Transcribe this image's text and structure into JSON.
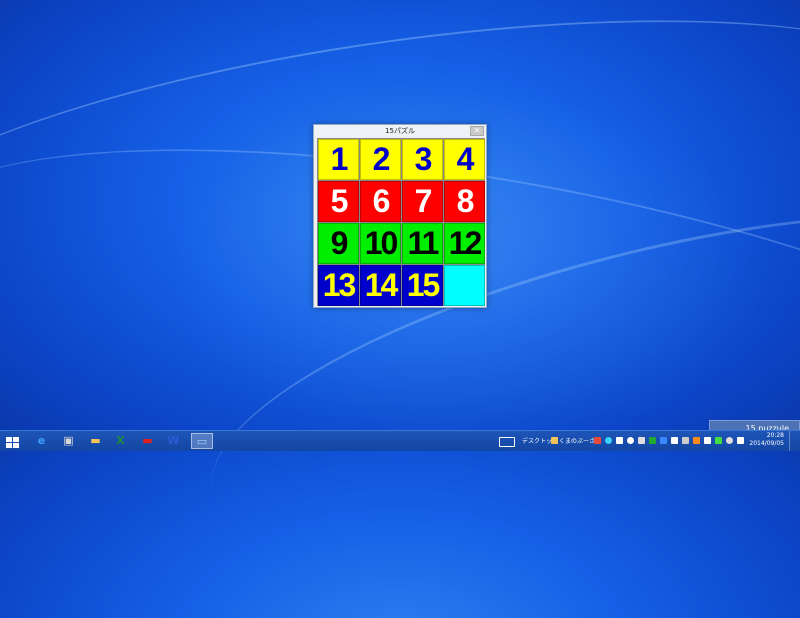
{
  "window": {
    "title": "15パズル",
    "close_symbol": "✕"
  },
  "board": {
    "tiles": [
      {
        "label": "1",
        "bg": "#ffff00",
        "fg": "#0000c8"
      },
      {
        "label": "2",
        "bg": "#ffff00",
        "fg": "#0000c8"
      },
      {
        "label": "3",
        "bg": "#ffff00",
        "fg": "#0000c8"
      },
      {
        "label": "4",
        "bg": "#ffff00",
        "fg": "#0000c8"
      },
      {
        "label": "5",
        "bg": "#ff0000",
        "fg": "#ffffff"
      },
      {
        "label": "6",
        "bg": "#ff0000",
        "fg": "#ffffff"
      },
      {
        "label": "7",
        "bg": "#ff0000",
        "fg": "#ffffff"
      },
      {
        "label": "8",
        "bg": "#ff0000",
        "fg": "#ffffff"
      },
      {
        "label": "9",
        "bg": "#00ee00",
        "fg": "#000000"
      },
      {
        "label": "10",
        "bg": "#00ee00",
        "fg": "#000000"
      },
      {
        "label": "11",
        "bg": "#00ee00",
        "fg": "#000000"
      },
      {
        "label": "12",
        "bg": "#00ee00",
        "fg": "#000000"
      },
      {
        "label": "13",
        "bg": "#0000cc",
        "fg": "#ffff00"
      },
      {
        "label": "14",
        "bg": "#0000cc",
        "fg": "#ffff00"
      },
      {
        "label": "15",
        "bg": "#0000cc",
        "fg": "#ffff00"
      },
      {
        "label": "",
        "bg": "#00ffff",
        "fg": "#000000"
      }
    ]
  },
  "taskbar": {
    "apps": [
      {
        "name": "start-button",
        "icon": "windows-logo"
      },
      {
        "name": "internet-explorer",
        "icon": "ie-icon",
        "glyph": "e",
        "color": "#3aa0ff"
      },
      {
        "name": "app-2",
        "icon": "app-icon",
        "glyph": "▣",
        "color": "#d8d8d8"
      },
      {
        "name": "file-explorer",
        "icon": "folder-icon",
        "glyph": "▬",
        "color": "#f2c45a"
      },
      {
        "name": "excel",
        "icon": "excel-icon",
        "glyph": "X",
        "color": "#1e8c3a"
      },
      {
        "name": "app-red",
        "icon": "red-app-icon",
        "glyph": "▬",
        "color": "#e02020"
      },
      {
        "name": "word",
        "icon": "word-icon",
        "glyph": "W",
        "color": "#2a5bd7"
      },
      {
        "name": "puzzle-app",
        "icon": "monitor-icon",
        "glyph": "▭",
        "color": "#9fd0ff"
      }
    ],
    "tray": {
      "desktop_label": "デスクトップ",
      "toolbar_label": "くまのぷーさ",
      "time": "20:28",
      "date": "2014/09/05"
    }
  },
  "tooltip": {
    "text": "15 puzzule"
  }
}
